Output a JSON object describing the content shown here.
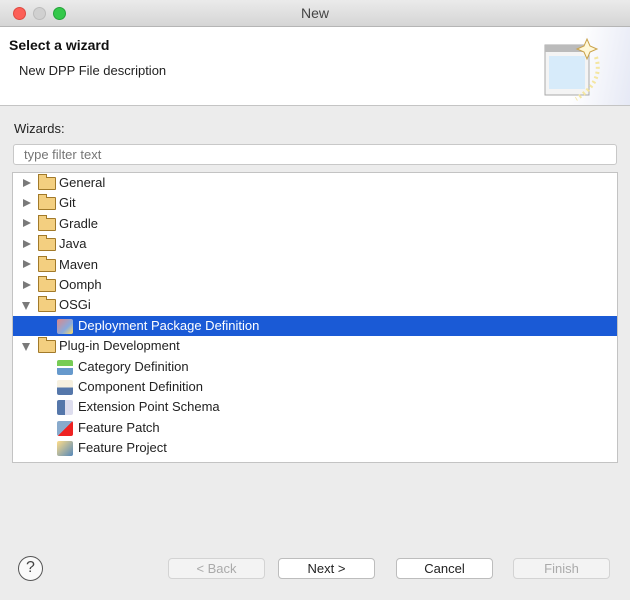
{
  "window": {
    "title": "New"
  },
  "header": {
    "title": "Select a wizard",
    "description": "New DPP File description"
  },
  "wizards_label": "Wizards:",
  "filter": {
    "value": "",
    "placeholder": "type filter text"
  },
  "tree": [
    {
      "label": "General",
      "type": "folder",
      "state": "collapsed"
    },
    {
      "label": "Git",
      "type": "folder",
      "state": "collapsed"
    },
    {
      "label": "Gradle",
      "type": "folder",
      "state": "collapsed"
    },
    {
      "label": "Java",
      "type": "folder",
      "state": "collapsed"
    },
    {
      "label": "Maven",
      "type": "folder",
      "state": "collapsed"
    },
    {
      "label": "Oomph",
      "type": "folder",
      "state": "collapsed"
    },
    {
      "label": "OSGi",
      "type": "folder",
      "state": "expanded"
    },
    {
      "label": "Deployment Package Definition",
      "type": "item",
      "icon": "deployment-package-icon",
      "selected": true
    },
    {
      "label": "Plug-in Development",
      "type": "folder",
      "state": "expanded"
    },
    {
      "label": "Category Definition",
      "type": "item",
      "icon": "category-definition-icon"
    },
    {
      "label": "Component Definition",
      "type": "item",
      "icon": "component-definition-icon"
    },
    {
      "label": "Extension Point Schema",
      "type": "item",
      "icon": "extension-point-schema-icon"
    },
    {
      "label": "Feature Patch",
      "type": "item",
      "icon": "feature-patch-icon"
    },
    {
      "label": "Feature Project",
      "type": "item",
      "icon": "feature-project-icon"
    }
  ],
  "buttons": {
    "back": "< Back",
    "next": "Next >",
    "cancel": "Cancel",
    "finish": "Finish",
    "help": "?"
  },
  "colors": {
    "selection": "#1a5ad6"
  }
}
